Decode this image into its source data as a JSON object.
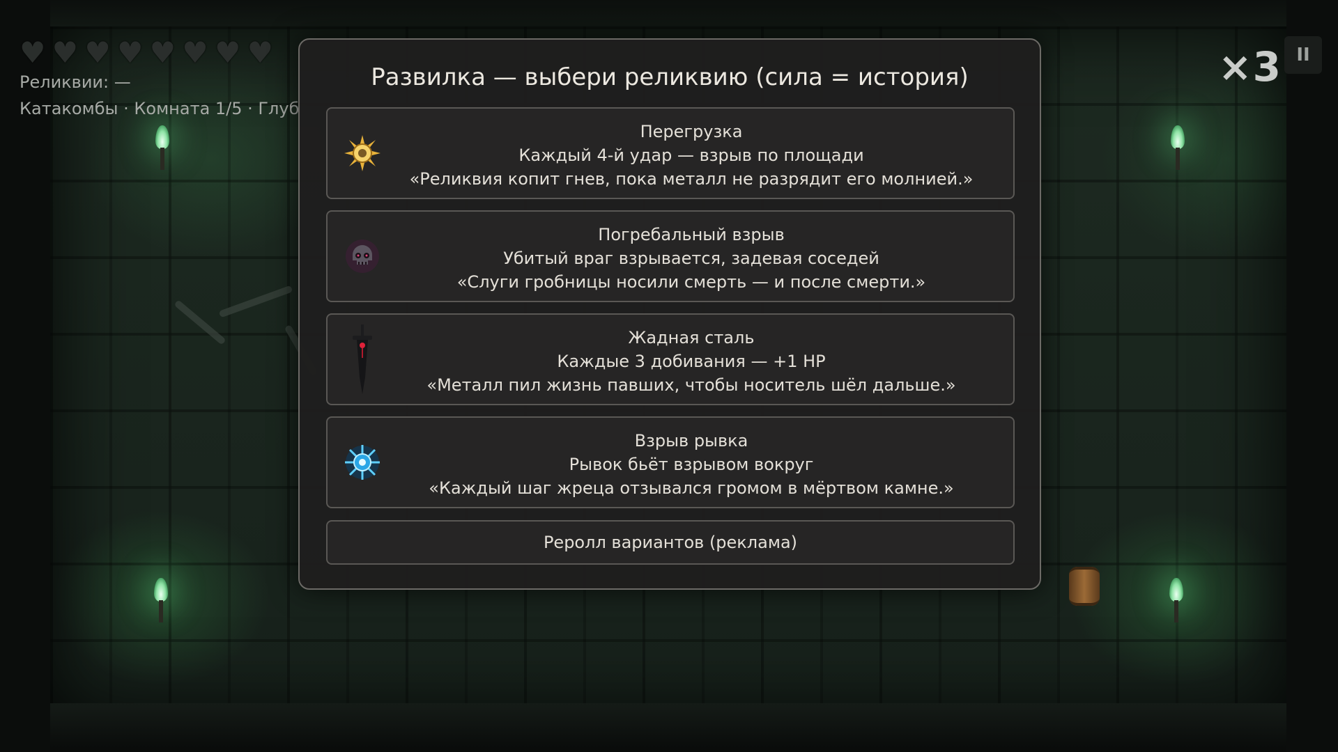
{
  "hud": {
    "hearts_count": 8,
    "relics_text": "Реликвии: —",
    "location_text": "Катакомбы · Комната 1/5  · Глуб",
    "combo": "×3",
    "pause_glyph": "II"
  },
  "modal": {
    "title": "Развилка — выбери реликвию  (сила = история)",
    "options": [
      {
        "name": "Перегрузка",
        "effect": "Каждый 4-й удар — взрыв по площади",
        "lore": "«Реликвия копит гнев, пока металл не разрядит его молнией.»",
        "icon": "sun-burst-icon"
      },
      {
        "name": "Погребальный взрыв",
        "effect": "Убитый враг взрывается, задевая соседей",
        "lore": "«Слуги гробницы носили смерть — и после смерти.»",
        "icon": "skull-icon"
      },
      {
        "name": "Жадная сталь",
        "effect": "Каждые 3 добивания — +1 HP",
        "lore": "«Металл пил жизнь павших, чтобы носитель шёл дальше.»",
        "icon": "dagger-icon"
      },
      {
        "name": "Взрыв рывка",
        "effect": "Рывок бьёт взрывом вокруг",
        "lore": "«Каждый шаг жреца отзывался громом в мёртвом камне.»",
        "icon": "blue-burst-icon"
      }
    ],
    "reroll_label": "Реролл вариантов (реклама)"
  },
  "colors": {
    "modal_bg": "#1f1e1e",
    "card_border": "#5a5855",
    "torch_glow": "#8fe3a6"
  }
}
